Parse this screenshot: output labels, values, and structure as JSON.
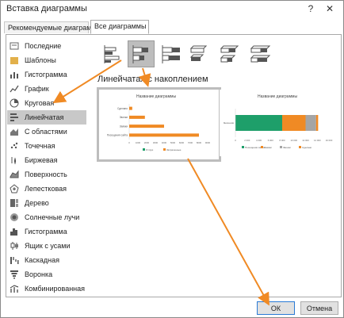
{
  "window": {
    "title": "Вставка диаграммы",
    "help_glyph": "?",
    "close_glyph": "✕"
  },
  "tabs": [
    {
      "label": "Рекомендуемые диаграммы",
      "active": false
    },
    {
      "label": "Все диаграммы",
      "active": true
    }
  ],
  "sidebar": {
    "items": [
      {
        "label": "Последние",
        "icon": "recent-icon"
      },
      {
        "label": "Шаблоны",
        "icon": "templates-icon"
      },
      {
        "label": "Гистограмма",
        "icon": "column-chart-icon"
      },
      {
        "label": "График",
        "icon": "line-chart-icon"
      },
      {
        "label": "Круговая",
        "icon": "pie-chart-icon"
      },
      {
        "label": "Линейчатая",
        "icon": "bar-chart-icon",
        "selected": true
      },
      {
        "label": "С областями",
        "icon": "area-chart-icon"
      },
      {
        "label": "Точечная",
        "icon": "scatter-chart-icon"
      },
      {
        "label": "Биржевая",
        "icon": "stock-chart-icon"
      },
      {
        "label": "Поверхность",
        "icon": "surface-chart-icon"
      },
      {
        "label": "Лепестковая",
        "icon": "radar-chart-icon"
      },
      {
        "label": "Дерево",
        "icon": "treemap-chart-icon"
      },
      {
        "label": "Солнечные лучи",
        "icon": "sunburst-chart-icon"
      },
      {
        "label": "Гистограмма",
        "icon": "histogram-chart-icon"
      },
      {
        "label": "Ящик с усами",
        "icon": "box-whisker-chart-icon"
      },
      {
        "label": "Каскадная",
        "icon": "waterfall-chart-icon"
      },
      {
        "label": "Воронка",
        "icon": "funnel-chart-icon"
      },
      {
        "label": "Комбинированная",
        "icon": "combo-chart-icon"
      }
    ]
  },
  "subtypes": [
    {
      "name": "clustered-bar"
    },
    {
      "name": "stacked-bar",
      "selected": true
    },
    {
      "name": "100-stacked-bar"
    },
    {
      "name": "3d-clustered-bar"
    },
    {
      "name": "3d-stacked-bar"
    },
    {
      "name": "3d-100-stacked-bar"
    }
  ],
  "subtype_heading": "Линейчатая с накоплением",
  "colors": {
    "green": "#1e9f6a",
    "orange": "#f08a24",
    "gray": "#a5a5a5",
    "accent": "#f08a24",
    "selection": "#bdbdbd"
  },
  "preview1": {
    "title": "Название диаграммы",
    "categories": [
      "Сделано",
      "Звонки",
      "Заявки",
      "Посещения сайта"
    ],
    "ticks": [
      "0",
      "1000",
      "2000",
      "3000",
      "4000",
      "5000",
      "6000",
      "7000",
      "8000",
      "9000"
    ],
    "legend": [
      "Отгруз",
      "Затраченные"
    ]
  },
  "preview2": {
    "title": "Название диаграммы",
    "category": "Значения",
    "ticks": [
      "0",
      "2 000",
      "4 000",
      "6 000",
      "8 000",
      "10 000",
      "12 000",
      "14 000",
      "16 000"
    ],
    "legend": [
      "Посещения сайта",
      "Заявки",
      "Звонки",
      "Сделано"
    ]
  },
  "chart_data": [
    {
      "type": "bar",
      "stacked": true,
      "title": "Название диаграммы",
      "categories": [
        "Посещения сайта",
        "Заявки",
        "Звонки",
        "Сделано"
      ],
      "series": [
        {
          "values": [
            8000,
            4000,
            1800,
            350
          ]
        }
      ],
      "xlim": [
        0,
        9000
      ]
    },
    {
      "type": "bar",
      "stacked": true,
      "title": "Название диаграммы",
      "categories": [
        "Значения"
      ],
      "series": [
        {
          "name": "Посещения сайта",
          "values": [
            8000
          ]
        },
        {
          "name": "Заявки",
          "values": [
            4000
          ]
        },
        {
          "name": "Звонки",
          "values": [
            1800
          ]
        },
        {
          "name": "Сделано",
          "values": [
            350
          ]
        }
      ],
      "xlim": [
        0,
        16000
      ]
    }
  ],
  "buttons": {
    "ok": "ОК",
    "cancel": "Отмена"
  }
}
